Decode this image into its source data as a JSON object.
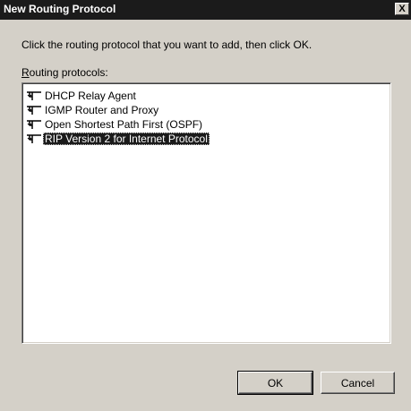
{
  "window": {
    "title": "New Routing Protocol",
    "close_label": "X"
  },
  "dialog": {
    "instruction": "Click the routing protocol that you want to add, then click OK.",
    "list_label_accel": "R",
    "list_label_rest": "outing protocols:",
    "items": [
      {
        "label": "DHCP Relay Agent",
        "icon": "routing-protocol-icon",
        "selected": false
      },
      {
        "label": "IGMP Router and Proxy",
        "icon": "routing-protocol-icon",
        "selected": false
      },
      {
        "label": "Open Shortest Path First (OSPF)",
        "icon": "routing-protocol-icon",
        "selected": false
      },
      {
        "label": "RIP Version 2 for Internet Protocol",
        "icon": "routing-protocol-icon",
        "selected": true
      }
    ]
  },
  "buttons": {
    "ok_label": "OK",
    "cancel_label": "Cancel"
  }
}
